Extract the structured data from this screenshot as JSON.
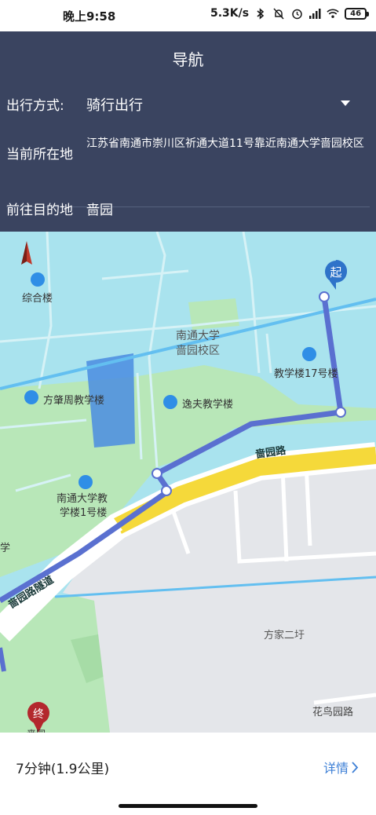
{
  "status_bar": {
    "time": "晚上9:58",
    "network_speed": "5.3K/s",
    "battery": "46"
  },
  "header": {
    "title": "导航",
    "mode_label": "出行方式:",
    "mode_value": "骑行出行",
    "location_label": "当前所在地",
    "location_value": "江苏省南通市崇川区祈通大道11号靠近南通大学啬园校区",
    "destination_label": "前往目的地",
    "destination_value": "啬园"
  },
  "map": {
    "labels": {
      "zonghelou": "综合楼",
      "campus": "南通大学\n啬园校区",
      "jiaoxuelou17": "教学楼17号楼",
      "fangzhaozhou": "方肇周教学楼",
      "yifu": "逸夫教学楼",
      "jiaoxuelou1": "南通大学教\n学楼1号楼",
      "xue": "学",
      "seyuan_road": "啬园路",
      "seyuan_tunnel": "啬园路隧道",
      "fangjia": "方家二圩",
      "huaniao": "花鸟园路",
      "start_marker": "起",
      "end_marker": "终",
      "end_partial": "啬园"
    },
    "colors": {
      "water": "#a9e3ee",
      "green": "#b8e7b8",
      "route": "#5a70d0",
      "road_yellow": "#f5d93a",
      "land": "#e4e6ea"
    }
  },
  "bottom": {
    "route_summary": "7分钟(1.9公里)",
    "details_label": "详情"
  }
}
